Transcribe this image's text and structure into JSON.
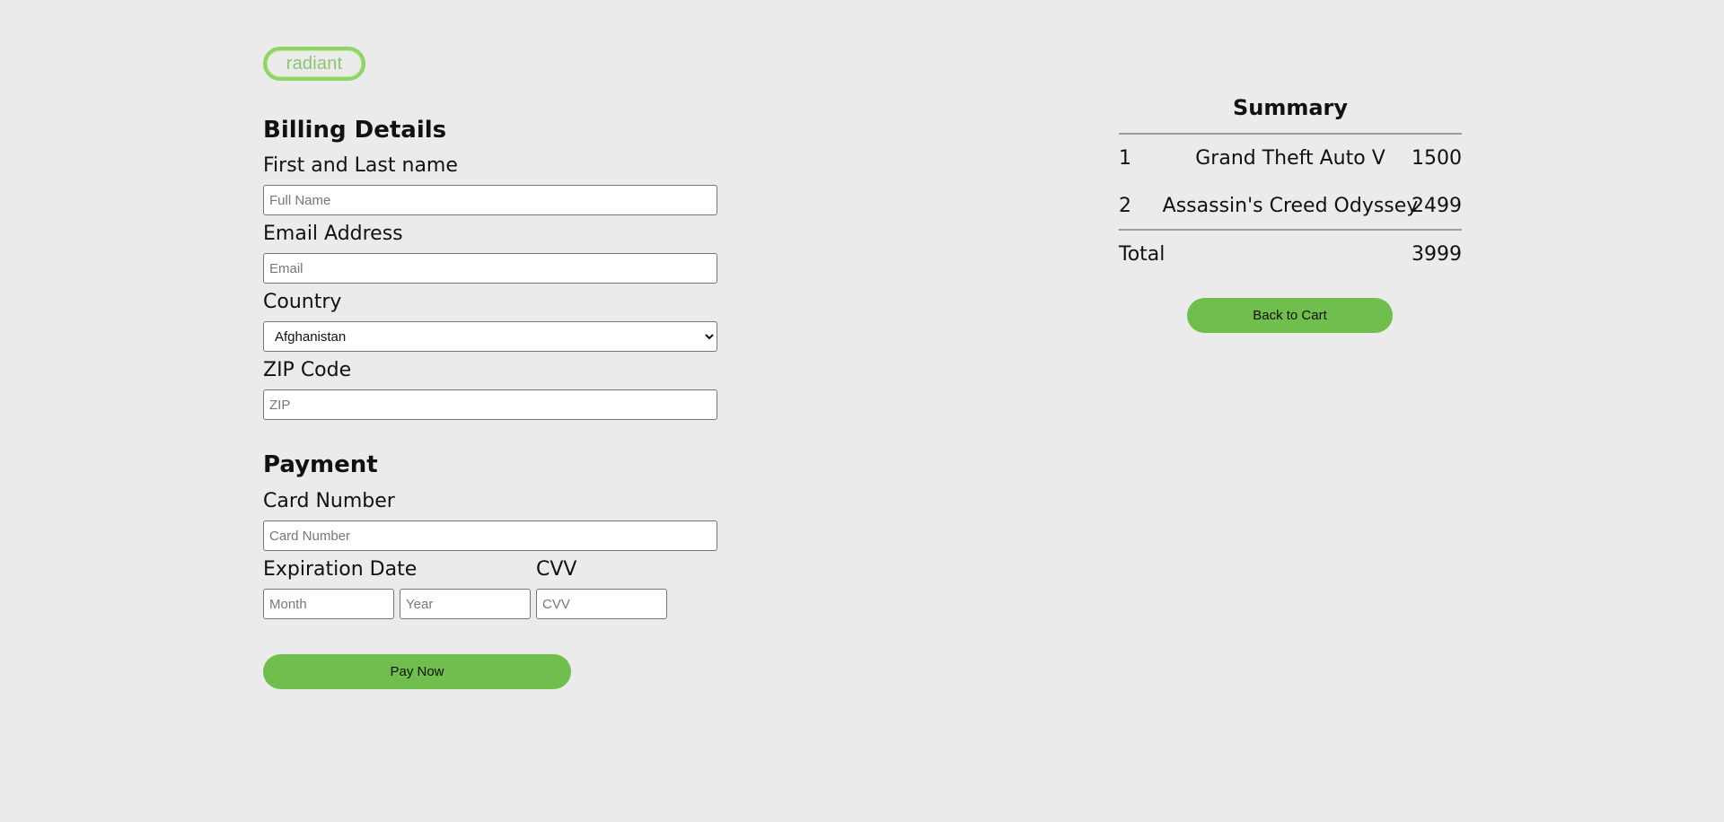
{
  "logo": {
    "text": "radiant"
  },
  "billing": {
    "heading": "Billing Details",
    "name_label": "First and Last name",
    "name_placeholder": "Full Name",
    "email_label": "Email Address",
    "email_placeholder": "Email",
    "country_label": "Country",
    "country_selected": "Afghanistan",
    "zip_label": "ZIP Code",
    "zip_placeholder": "ZIP"
  },
  "payment": {
    "heading": "Payment",
    "card_label": "Card Number",
    "card_placeholder": "Card Number",
    "expiration_label": "Expiration Date",
    "month_placeholder": "Month",
    "year_placeholder": "Year",
    "cvv_label": "CVV",
    "cvv_placeholder": "CVV",
    "pay_button": "Pay Now"
  },
  "summary": {
    "title": "Summary",
    "items": [
      {
        "index": "1",
        "name": "Grand Theft Auto V",
        "price": "1500"
      },
      {
        "index": "2",
        "name": "Assassin's Creed Odyssey",
        "price": "2499"
      }
    ],
    "total_label": "Total",
    "total_value": "3999",
    "back_button": "Back to Cart"
  },
  "colors": {
    "background": "#ebebeb",
    "accent_green": "#6fbe4e",
    "logo_green": "#8fd36a"
  }
}
